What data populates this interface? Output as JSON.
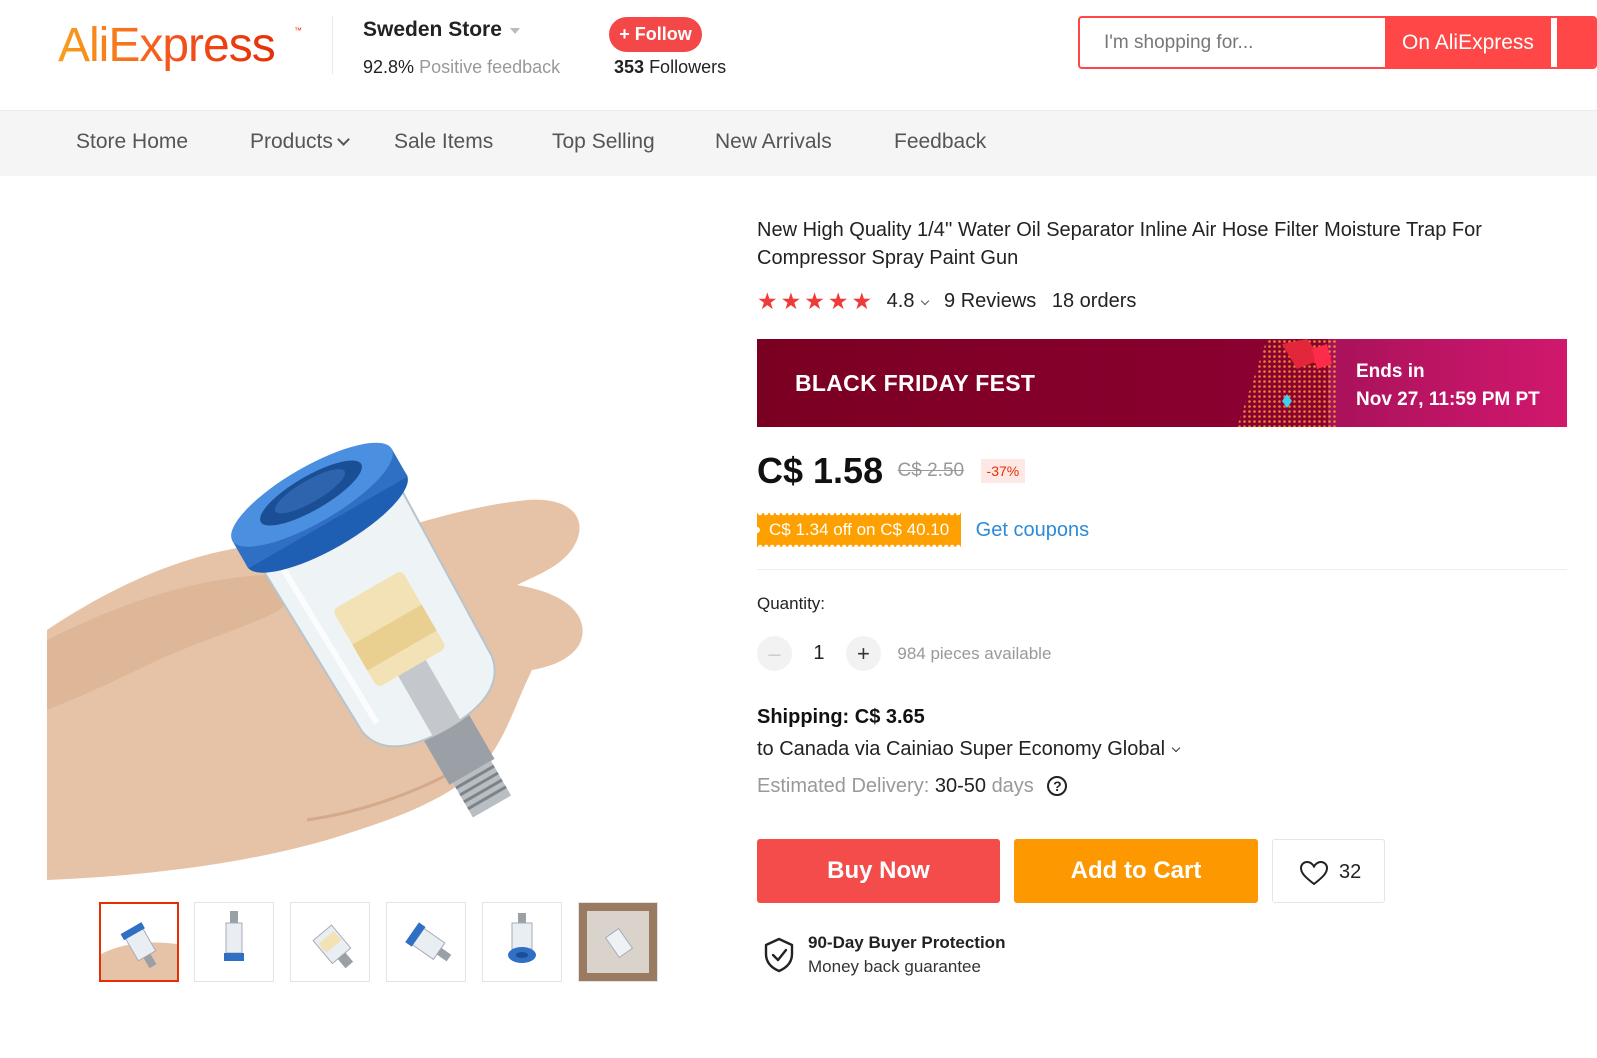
{
  "header": {
    "logo_text": "AliExpress",
    "logo_tm": "™",
    "store_name": "Sweden Store",
    "positive_feedback_value": "92.8%",
    "positive_feedback_label": "Positive feedback",
    "follow_label": "+ Follow",
    "followers_count": "353",
    "followers_label": "Followers",
    "search_placeholder": "I'm shopping for...",
    "search_button_label": "On AliExpress"
  },
  "nav": {
    "items": [
      {
        "label": "Store Home"
      },
      {
        "label": "Products"
      },
      {
        "label": "Sale Items"
      },
      {
        "label": "Top Selling"
      },
      {
        "label": "New Arrivals"
      },
      {
        "label": "Feedback"
      }
    ]
  },
  "gallery": {
    "thumbnail_count": 6,
    "active_index": 0
  },
  "product": {
    "title": "New High Quality 1/4'' Water Oil Separator Inline Air Hose Filter Moisture Trap For Compressor Spray Paint Gun",
    "stars": "★★★★★",
    "rating": "4.8",
    "reviews": "9 Reviews",
    "orders": "18 orders",
    "promo_title": "BLACK FRIDAY FEST",
    "promo_ends_label": "Ends in",
    "promo_ends_date": "Nov 27, 11:59 PM PT",
    "price": "C$ 1.58",
    "original_price": "C$ 2.50",
    "discount": "-37%",
    "coupon_text": "C$ 1.34 off on C$ 40.10",
    "get_coupons_label": "Get coupons",
    "quantity_label": "Quantity:",
    "quantity_minus": "–",
    "quantity_value": "1",
    "quantity_plus": "+",
    "pieces_available": "984 pieces available",
    "shipping_price": "Shipping: C$ 3.65",
    "shipping_method": "to Canada via Cainiao Super Economy Global",
    "delivery_label": "Estimated Delivery:",
    "delivery_value": "30-50",
    "delivery_unit": "days",
    "help_symbol": "?",
    "buy_now_label": "Buy Now",
    "add_to_cart_label": "Add to Cart",
    "wishlist_count": "32",
    "protection_title": "90-Day Buyer Protection",
    "protection_sub": "Money back guarantee"
  },
  "colors": {
    "accent_red": "#f44b4b",
    "cart_orange": "#fd9800",
    "promo_dark": "#7a0021",
    "link_blue": "#2e8ad8"
  },
  "icons": [
    "chevron-down-icon",
    "star-icon",
    "heart-icon",
    "shield-check-icon",
    "help-circle-icon",
    "plus-icon",
    "minus-icon"
  ]
}
